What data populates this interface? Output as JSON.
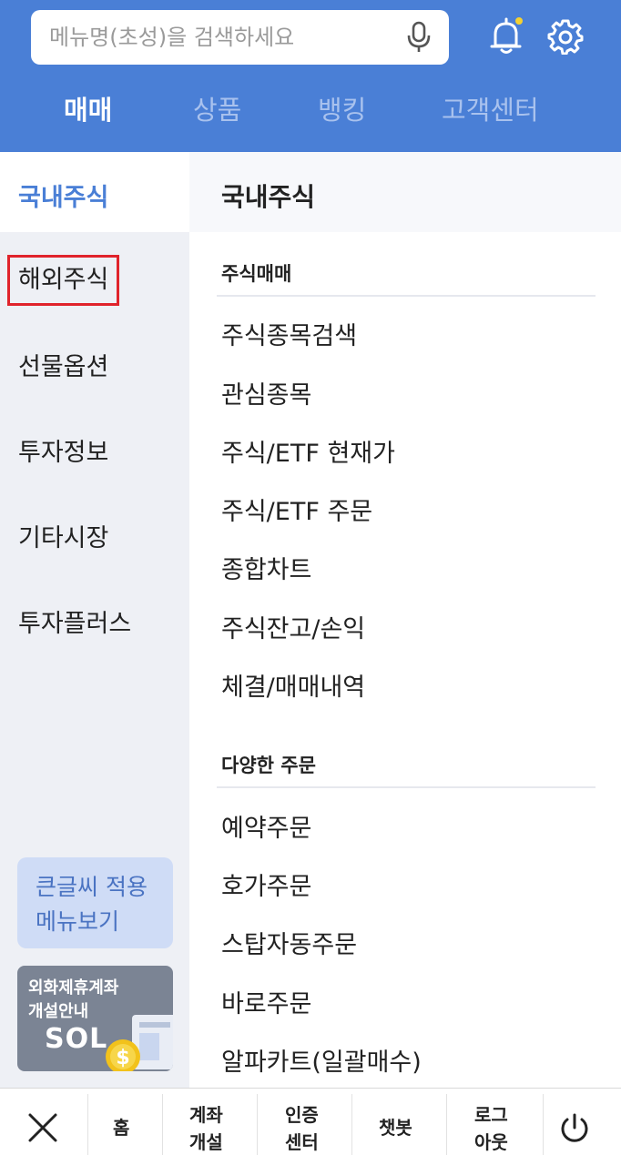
{
  "header": {
    "search_placeholder": "메뉴명(초성)을 검색하세요",
    "tabs": [
      "매매",
      "상품",
      "뱅킹",
      "고객센터"
    ],
    "active_tab": "매매"
  },
  "leftnav": {
    "items": [
      "국내주식",
      "해외주식",
      "선물옵션",
      "투자정보",
      "기타시장",
      "투자플러스"
    ],
    "active": "국내주식",
    "bigfont_button": {
      "line1": "큰글씨 적용",
      "line2": "메뉴보기"
    },
    "banner": {
      "line1": "외화제휴계좌",
      "line2": "개설안내",
      "logo": "SOL"
    }
  },
  "content": {
    "title": "국내주식",
    "sections": [
      {
        "title": "주식매매",
        "items": [
          "주식종목검색",
          "관심종목",
          "주식/ETF 현재가",
          "주식/ETF 주문",
          "종합차트",
          "주식잔고/손익",
          "체결/매매내역"
        ]
      },
      {
        "title": "다양한 주문",
        "items": [
          "예약주문",
          "호가주문",
          "스탑자동주문",
          "바로주문",
          "알파카트(일괄매수)"
        ]
      }
    ]
  },
  "bottombar": {
    "home": "홈",
    "account_open": [
      "계좌",
      "개설"
    ],
    "cert_center": [
      "인증",
      "센터"
    ],
    "chatbot": "챗봇",
    "logout": [
      "로그",
      "아웃"
    ]
  },
  "colors": {
    "brand_blue": "#4a7fd6",
    "highlight_red": "#e0232b",
    "notification_dot": "#f5d130"
  },
  "icons": [
    "mic-icon",
    "bell-icon",
    "gear-icon",
    "close-icon",
    "power-icon",
    "coin-icon"
  ]
}
